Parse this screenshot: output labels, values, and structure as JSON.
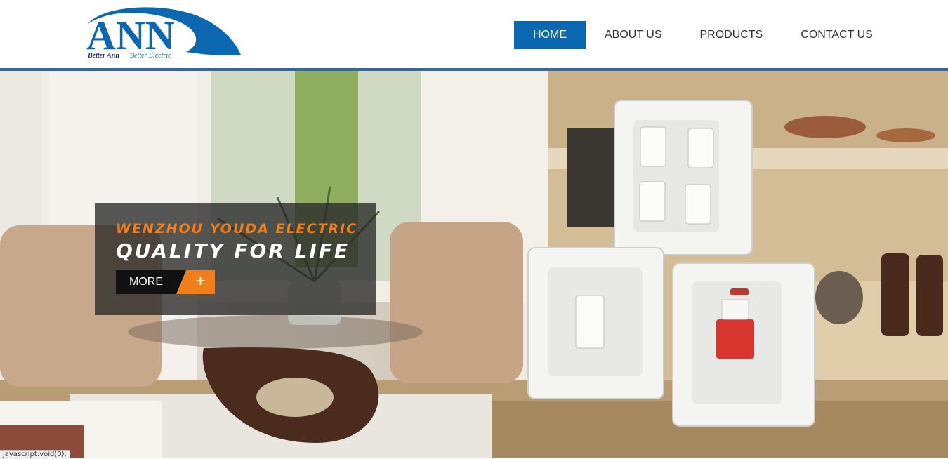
{
  "logo": {
    "brand": "ANN",
    "tagline_part1": "Better Ann",
    "tagline_part2": "Better Electric"
  },
  "nav": {
    "items": [
      {
        "label": "HOME",
        "active": true
      },
      {
        "label": "ABOUT US",
        "active": false
      },
      {
        "label": "PRODUCTS",
        "active": false
      },
      {
        "label": "CONTACT US",
        "active": false
      }
    ]
  },
  "hero": {
    "caption_line1": "WENZHOU YOUDA ELECTRIC",
    "caption_line2": "QUALITY FOR LIFE",
    "more_label": "MORE",
    "more_icon": "+"
  },
  "status_bar": {
    "text": "javascript:void(0);"
  },
  "colors": {
    "brand_blue": "#0b67b0",
    "accent_orange": "#f07e1b",
    "switch_red": "#d9352f"
  }
}
